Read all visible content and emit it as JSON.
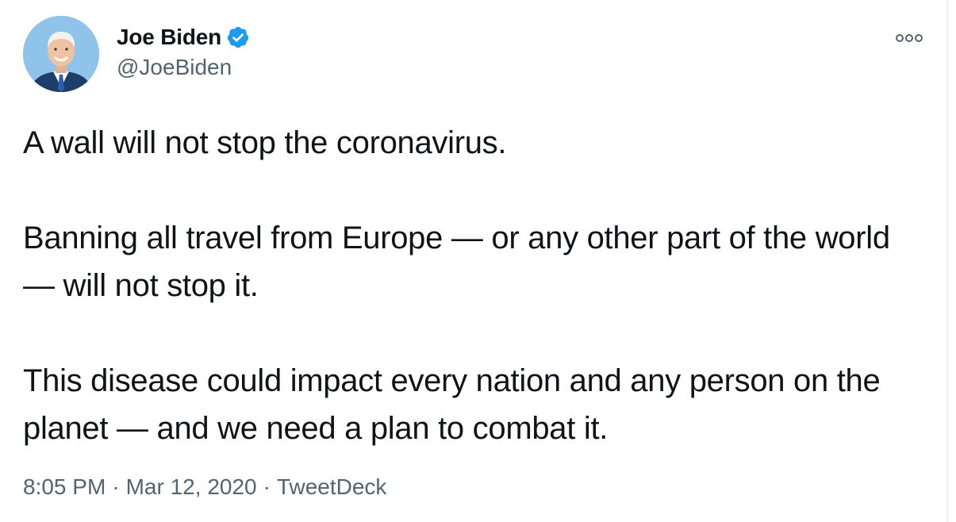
{
  "user": {
    "display_name": "Joe Biden",
    "handle": "@JoeBiden",
    "verified": true
  },
  "tweet": {
    "paragraphs": [
      "A wall will not stop the coronavirus.",
      "Banning all travel from Europe — or any other part of the world — will not stop it.",
      "This disease could impact every nation and any person on the planet — and we need a plan to combat it."
    ],
    "time": "8:05 PM",
    "date": "Mar 12, 2020",
    "source": "TweetDeck",
    "separator": "·"
  },
  "icons": {
    "verified": "verified-badge-icon",
    "more": "more-options-icon"
  },
  "colors": {
    "accent": "#1d9bf0",
    "text": "#0f1419",
    "secondary_text": "#536471"
  }
}
